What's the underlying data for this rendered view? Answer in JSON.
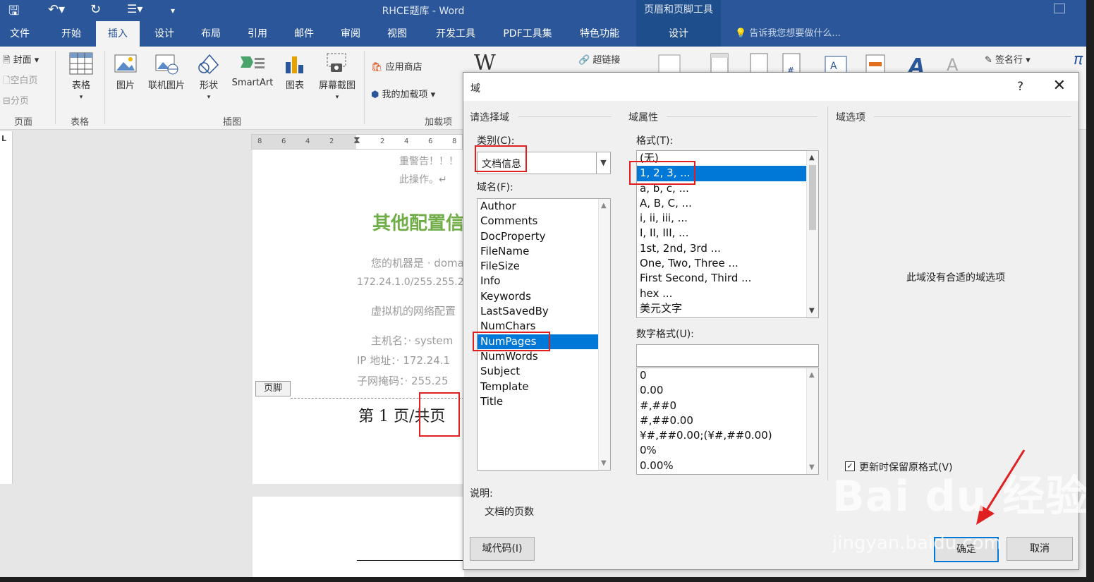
{
  "window": {
    "title": "RHCE题库 - Word",
    "context_title": "页眉和页脚工具"
  },
  "tabs": [
    {
      "label": "文件"
    },
    {
      "label": "开始"
    },
    {
      "label": "插入"
    },
    {
      "label": "设计"
    },
    {
      "label": "布局"
    },
    {
      "label": "引用"
    },
    {
      "label": "邮件"
    },
    {
      "label": "审阅"
    },
    {
      "label": "视图"
    },
    {
      "label": "开发工具"
    },
    {
      "label": "PDF工具集"
    },
    {
      "label": "特色功能"
    },
    {
      "label": "设计"
    }
  ],
  "tell_me": "告诉我您想要做什么...",
  "ribbon": {
    "pages_group": {
      "cover": "封面",
      "blank": "空白页",
      "break": "分页",
      "label": "页面"
    },
    "table_group": {
      "table": "表格",
      "label": "表格"
    },
    "illus_group": {
      "picture": "图片",
      "online_picture": "联机图片",
      "shapes": "形状",
      "smartart": "SmartArt",
      "chart": "图表",
      "screenshot": "屏幕截图",
      "label": "插图"
    },
    "addins_group": {
      "store": "应用商店",
      "my_addins": "我的加载项",
      "label": "加载项"
    },
    "wiki": "W",
    "hyperlink": "超链接",
    "signature_line": "签名行",
    "pi": "π"
  },
  "ruler": [
    "8",
    "6",
    "4",
    "2",
    "2",
    "4",
    "6",
    "8"
  ],
  "document": {
    "line1": "重警告！！！",
    "line2": "此操作。↵",
    "heading": "其他配置信",
    "p1": "您的机器是 · doma",
    "p2": "172.24.1.0/255.255.25",
    "p3": "虚拟机的网络配置",
    "p4": "主机名：· system",
    "p5": "IP 地址：· 172.24.1",
    "p6": "子网掩码：· 255.25",
    "footer_tag": "页脚",
    "footer_text": "第 1 页/共页"
  },
  "dialog": {
    "title": "域",
    "help": "?",
    "close": "✕",
    "select_field": "请选择域",
    "category_label": "类别(C):",
    "category_value": "文档信息",
    "fieldname_label": "域名(F):",
    "field_names": [
      "Author",
      "Comments",
      "DocProperty",
      "FileName",
      "FileSize",
      "Info",
      "Keywords",
      "LastSavedBy",
      "NumChars",
      "NumPages",
      "NumWords",
      "Subject",
      "Template",
      "Title"
    ],
    "field_selected": "NumPages",
    "field_props": "域属性",
    "format_label": "格式(T):",
    "formats": [
      "(无)",
      "1, 2, 3, ...",
      "a, b, c, ...",
      "A, B, C, ...",
      "i, ii, iii, ...",
      "I, II, III, ...",
      "1st, 2nd, 3rd ...",
      "One, Two, Three ...",
      "First Second, Third ...",
      "hex ...",
      "美元文字"
    ],
    "format_selected": "1, 2, 3, ...",
    "number_format_label": "数字格式(U):",
    "number_format_value": "",
    "number_formats": [
      "0",
      "0.00",
      "#,##0",
      "#,##0.00",
      "¥#,##0.00;(¥#,##0.00)",
      "0%",
      "0.00%"
    ],
    "field_options": "域选项",
    "no_options": "此域没有合适的域选项",
    "preserve_label": "更新时保留原格式(V)",
    "preserve_checked": true,
    "description_label": "说明:",
    "description": "文档的页数",
    "field_codes_btn": "域代码(I)",
    "ok_btn": "确定",
    "cancel_btn": "取消"
  },
  "watermark": {
    "text": "Bai du 经验",
    "url": "jingyan.baidu.com"
  },
  "colors": {
    "titlebar": "#2b579a",
    "accent": "#0078d7",
    "highlight": "#e02020",
    "heading": "#70ad47"
  }
}
